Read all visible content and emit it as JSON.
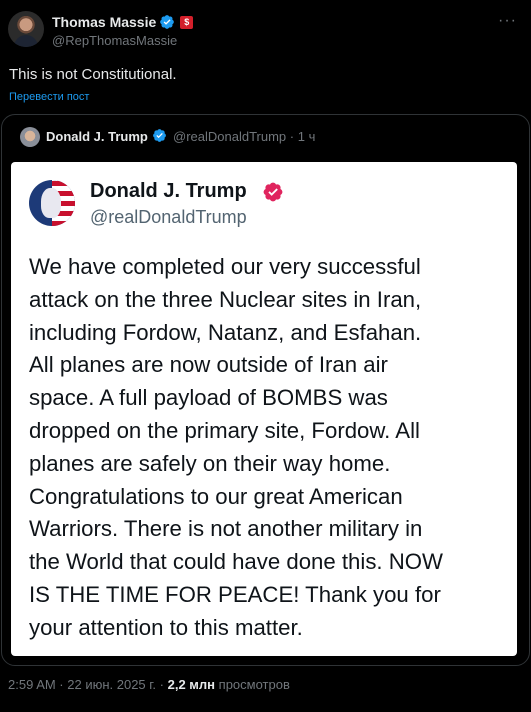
{
  "author": {
    "name": "Thomas Massie",
    "handle": "@RepThomasMassie",
    "flag_label": "$"
  },
  "more_label": "···",
  "post_text": "This is not Constitutional.",
  "translate_label": "Перевести пост",
  "quoted": {
    "name": "Donald J. Trump",
    "handle": "@realDonaldTrump",
    "time": "· 1 ч",
    "card": {
      "name": "Donald J. Trump",
      "handle": "@realDonaldTrump",
      "lines": [
        "We have completed our very successful",
        "attack on the three Nuclear sites in Iran,",
        "including Fordow, Natanz, and Esfahan.",
        "All planes are now outside of Iran air",
        "space. A full payload of BOMBS was",
        "dropped on the primary site, Fordow. All",
        "planes are safely on their way home.",
        "Congratulations to our great American",
        "Warriors. There is not another military in",
        "the World that could have done this. NOW",
        "IS THE TIME FOR PEACE! Thank you for",
        "your attention to this matter."
      ]
    }
  },
  "meta": {
    "time": "2:59 AM · 22 июн. 2025 г. ·",
    "views_count": "2,2 млн",
    "views_label": "просмотров"
  },
  "colors": {
    "background": "#000000",
    "link_blue": "#1d9bf0",
    "muted_gray": "#71767b",
    "verified_blue": "#1d9bf0",
    "card_badge_pink": "#e0245e"
  },
  "icons": [
    "avatar",
    "verified-badge-icon",
    "flag-badge-icon",
    "more-options-icon"
  ]
}
